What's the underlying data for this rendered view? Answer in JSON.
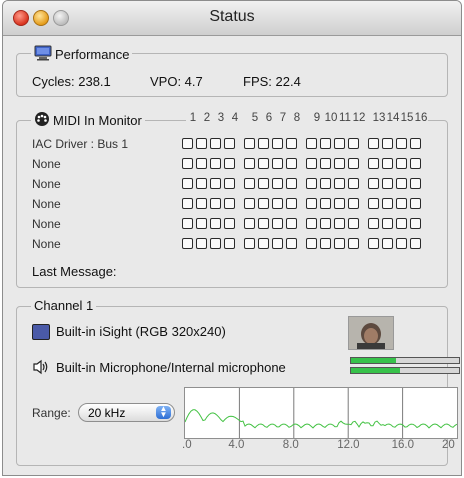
{
  "window": {
    "title": "Status"
  },
  "performance": {
    "legend": "Performance",
    "cycles_label": "Cycles: 238.1",
    "vpo_label": "VPO: 4.7",
    "fps_label": "FPS: 22.4"
  },
  "midi": {
    "legend": "MIDI In Monitor",
    "channels": [
      "1",
      "2",
      "3",
      "4",
      "5",
      "6",
      "7",
      "8",
      "9",
      "10",
      "11",
      "12",
      "13",
      "14",
      "15",
      "16"
    ],
    "devices": [
      "IAC Driver : Bus 1",
      "None",
      "None",
      "None",
      "None",
      "None"
    ],
    "last_message_label": "Last Message:"
  },
  "channel": {
    "legend": "Channel 1",
    "video_source": "Built-in iSight (RGB 320x240)",
    "audio_source": "Built-in Microphone/Internal microphone",
    "audio_levels": [
      0.42,
      0.45
    ],
    "range_label": "Range:",
    "range_value": "20 kHz",
    "freq_ticks": [
      ".0",
      "4.0",
      "8.0",
      "12.0",
      "16.0",
      "20"
    ],
    "colors": {
      "meter": "#37c24a",
      "spectrum_line": "#44c244",
      "isight_icon": "#4a5aa8"
    }
  }
}
